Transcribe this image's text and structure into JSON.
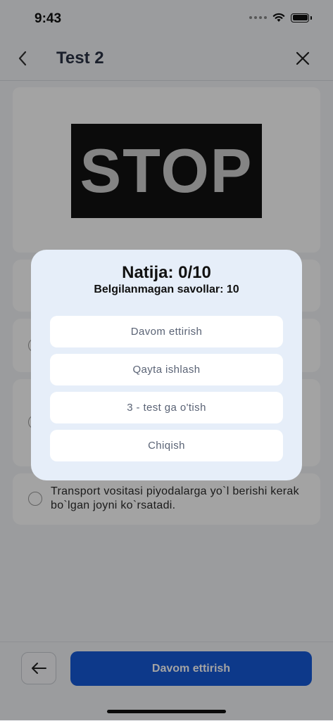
{
  "status_bar": {
    "time": "9:43"
  },
  "header": {
    "title": "Test 2"
  },
  "question": {
    "sign_text": "STOP"
  },
  "options": [
    {
      "text": ""
    },
    {
      "text": ""
    },
    {
      "text": ""
    },
    {
      "text": "Transport vositasi piyodalarga yo`l berishi kerak bo`lgan joyni ko`rsatadi."
    }
  ],
  "bottom_bar": {
    "continue_label": "Davom ettirish"
  },
  "modal": {
    "title": "Natija: 0/10",
    "subtitle": "Belgilanmagan savollar: 10",
    "buttons": [
      {
        "label": "Davom ettirish"
      },
      {
        "label": "Qayta ishlash"
      },
      {
        "label": "3 - test ga o'tish"
      },
      {
        "label": "Chiqish"
      }
    ]
  },
  "colors": {
    "accent": "#1559d8",
    "modal_bg": "#e6eef9"
  }
}
